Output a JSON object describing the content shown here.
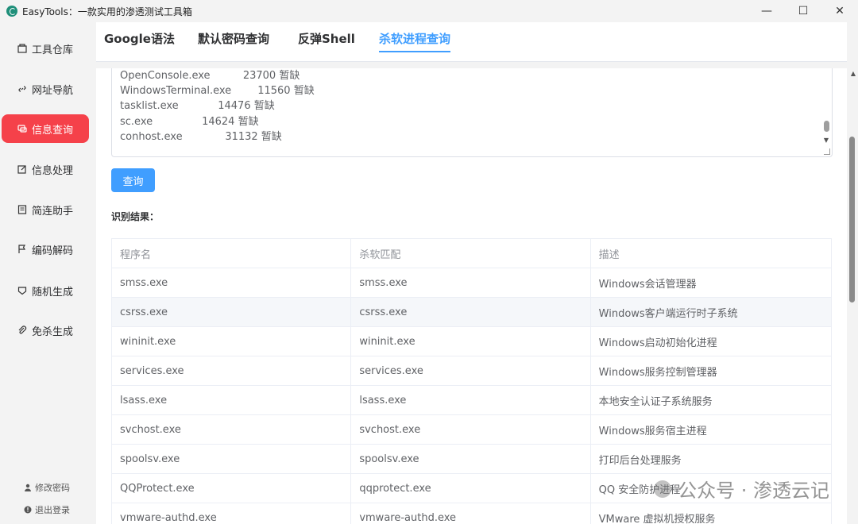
{
  "window": {
    "title": "EasyTools：一款实用的渗透测试工具箱",
    "controls": {
      "minimize": "—",
      "maximize": "☐",
      "close": "✕"
    }
  },
  "sidebar": {
    "items": [
      {
        "label": "工具仓库",
        "icon": "box-icon"
      },
      {
        "label": "网址导航",
        "icon": "link-icon"
      },
      {
        "label": "信息查询",
        "icon": "chat-icon",
        "active": true
      },
      {
        "label": "信息处理",
        "icon": "edit-icon"
      },
      {
        "label": "简连助手",
        "icon": "note-icon"
      },
      {
        "label": "编码解码",
        "icon": "flag-icon"
      },
      {
        "label": "随机生成",
        "icon": "shield-icon"
      },
      {
        "label": "免杀生成",
        "icon": "paperclip-icon"
      }
    ],
    "bottom": [
      {
        "label": "修改密码",
        "icon": "user-icon"
      },
      {
        "label": "退出登录",
        "icon": "info-icon"
      }
    ]
  },
  "tabs": [
    {
      "label": "Google语法"
    },
    {
      "label": "默认密码查询"
    },
    {
      "label": "反弹Shell"
    },
    {
      "label": "杀软进程查询",
      "active": true
    }
  ],
  "textarea": {
    "lines": [
      "OpenConsole.exe          23700 暂缺",
      "WindowsTerminal.exe        11560 暂缺",
      "tasklist.exe            14476 暂缺",
      "sc.exe               14624 暂缺",
      "conhost.exe             31132 暂缺"
    ]
  },
  "query_button": "查询",
  "result_label": "识别结果：",
  "table": {
    "headers": [
      "程序名",
      "杀软匹配",
      "描述"
    ],
    "rows": [
      [
        "smss.exe",
        "smss.exe",
        "Windows会话管理器"
      ],
      [
        "csrss.exe",
        "csrss.exe",
        "Windows客户端运行时子系统"
      ],
      [
        "wininit.exe",
        "wininit.exe",
        "Windows启动初始化进程"
      ],
      [
        "services.exe",
        "services.exe",
        "Windows服务控制管理器"
      ],
      [
        "lsass.exe",
        "lsass.exe",
        "本地安全认证子系统服务"
      ],
      [
        "svchost.exe",
        "svchost.exe",
        "Windows服务宿主进程"
      ],
      [
        "spoolsv.exe",
        "spoolsv.exe",
        "打印后台处理服务"
      ],
      [
        "QQProtect.exe",
        "qqprotect.exe",
        "QQ 安全防护进程"
      ],
      [
        "vmware-authd.exe",
        "vmware-authd.exe",
        "VMware 虚拟机授权服务"
      ]
    ]
  },
  "watermark": "公众号 · 渗透云记"
}
